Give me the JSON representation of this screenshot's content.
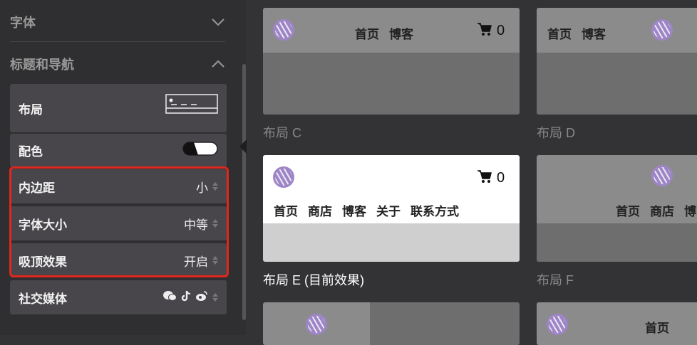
{
  "sidebar": {
    "sections": [
      {
        "title": "字体",
        "state": "collapsed"
      },
      {
        "title": "标题和导航",
        "state": "expanded"
      }
    ],
    "options": {
      "layout": {
        "label": "布局"
      },
      "colors": {
        "label": "配色"
      },
      "padding": {
        "label": "内边距",
        "value": "小"
      },
      "font_size": {
        "label": "字体大小",
        "value": "中等"
      },
      "sticky": {
        "label": "吸顶效果",
        "value": "开启"
      },
      "social": {
        "label": "社交媒体",
        "icons": [
          "wechat-icon",
          "tiktok-icon",
          "weibo-icon"
        ]
      }
    }
  },
  "layouts": {
    "C": {
      "caption": "布局 C",
      "nav": [
        "首页",
        "博客"
      ],
      "cart_count": "0"
    },
    "D": {
      "caption": "布局 D",
      "nav": [
        "首页",
        "博客"
      ]
    },
    "E": {
      "caption": "布局 E (目前效果)",
      "nav": [
        "首页",
        "商店",
        "博客",
        "关于",
        "联系方式"
      ],
      "cart_count": "0"
    },
    "F": {
      "caption": "布局 F",
      "nav": [
        "首页",
        "商店",
        "博"
      ]
    },
    "G": {
      "nav": []
    },
    "H": {
      "nav": [
        "首页"
      ]
    }
  },
  "colors": {
    "highlight": "#e2261c",
    "accent_logo": "#9e86c6"
  }
}
